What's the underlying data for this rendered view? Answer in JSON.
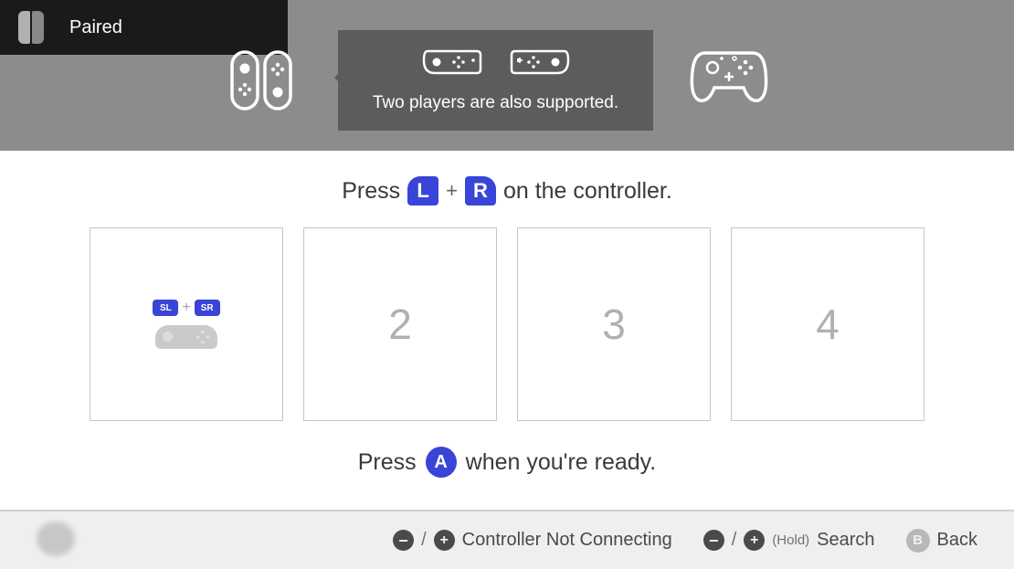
{
  "header": {
    "paired_label": "Paired",
    "tooltip_text": "Two players are also supported."
  },
  "instructions": {
    "press_lr_prefix": "Press",
    "l_label": "L",
    "r_label": "R",
    "press_lr_suffix": "on the controller.",
    "press_a_prefix": "Press",
    "a_label": "A",
    "press_a_suffix": "when you're ready."
  },
  "slots": {
    "slot1": {
      "sl_label": "SL",
      "sr_label": "SR"
    },
    "slot2_label": "2",
    "slot3_label": "3",
    "slot4_label": "4"
  },
  "footer": {
    "controller_not_connecting": "Controller Not Connecting",
    "hold_label": "(Hold)",
    "search_label": "Search",
    "b_label": "B",
    "back_label": "Back"
  }
}
